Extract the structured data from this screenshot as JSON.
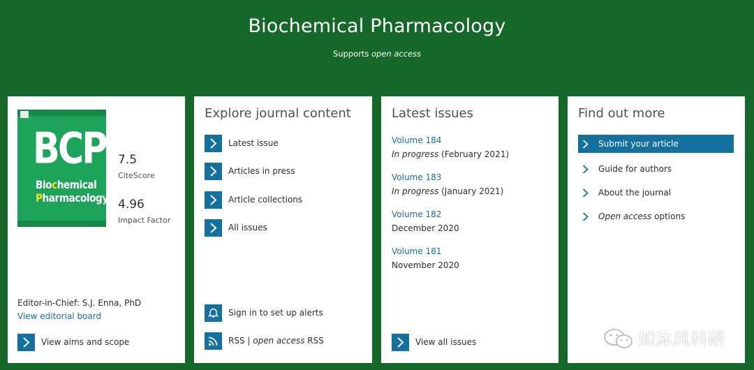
{
  "header": {
    "title": "Biochemical Pharmacology",
    "supports_prefix": "Supports",
    "supports_em": "open access"
  },
  "overview": {
    "cover_big": "BCP",
    "cover_line1_a": "Bio",
    "cover_line1_b": "c",
    "cover_line1_c": "hemical",
    "cover_line2_a": "P",
    "cover_line2_b": "harmacology",
    "citescore_value": "7.5",
    "citescore_label": "CiteScore",
    "impact_value": "4.96",
    "impact_label": "Impact Factor",
    "editor": "Editor-in-Chief: S.J. Enna, PhD",
    "editorial_board_link": "View editorial board",
    "aims_label": "View aims and scope"
  },
  "explore": {
    "title": "Explore journal content",
    "items": [
      "Latest issue",
      "Articles in press",
      "Article collections",
      "All issues"
    ],
    "alerts_label": "Sign in to set up alerts",
    "rss_prefix": "RSS | ",
    "rss_em": "open access",
    "rss_suffix": " RSS"
  },
  "latest": {
    "title": "Latest issues",
    "volumes": [
      {
        "name": "Volume 184",
        "status": "In progress",
        "date": "(February 2021)"
      },
      {
        "name": "Volume 183",
        "status": "In progress",
        "date": "(January 2021)"
      },
      {
        "name": "Volume 182",
        "status": "",
        "date": "December 2020"
      },
      {
        "name": "Volume 181",
        "status": "",
        "date": "November 2020"
      }
    ],
    "view_all_label": "View all issues"
  },
  "findout": {
    "title": "Find out more",
    "items": [
      "Submit your article",
      "Guide for authors",
      "About the journal"
    ],
    "oa_em": "Open access",
    "oa_suffix": " options"
  },
  "watermark": {
    "text": "如沐风科研"
  },
  "colors": {
    "background": "#16672a",
    "accent": "#14719f",
    "link": "#1a6ea1"
  }
}
